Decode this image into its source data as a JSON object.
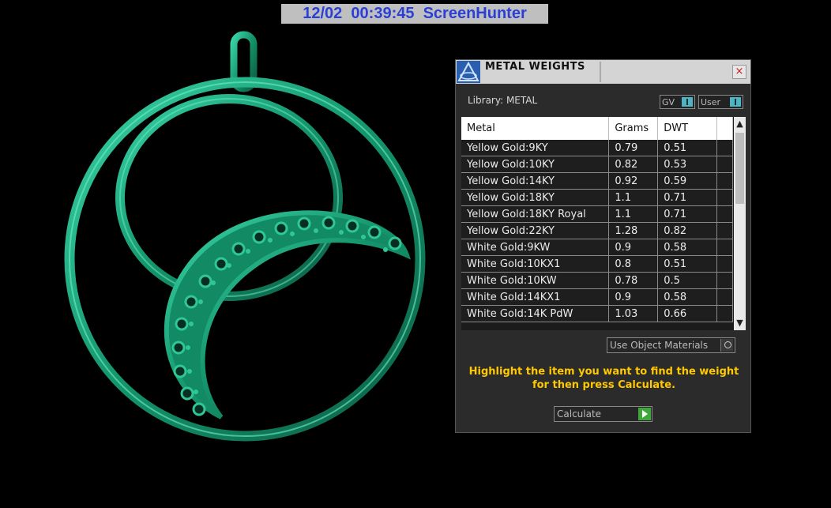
{
  "banner": {
    "text": "12/02  00:39:45  ScreenHunter"
  },
  "panel": {
    "title": "METAL WEIGHTS",
    "close_label": "×",
    "library_label": "Library: METAL",
    "toggle_gv_label": "GV",
    "toggle_user_label": "User",
    "table": {
      "headers": [
        "Metal",
        "Grams",
        "DWT"
      ],
      "rows": [
        [
          "Yellow Gold:9KY",
          "0.79",
          "0.51"
        ],
        [
          "Yellow Gold:10KY",
          "0.82",
          "0.53"
        ],
        [
          "Yellow Gold:14KY",
          "0.92",
          "0.59"
        ],
        [
          "Yellow Gold:18KY",
          "1.1",
          "0.71"
        ],
        [
          "Yellow Gold:18KY Royal",
          "1.1",
          "0.71"
        ],
        [
          "Yellow Gold:22KY",
          "1.28",
          "0.82"
        ],
        [
          "White Gold:9KW",
          "0.9",
          "0.58"
        ],
        [
          "White Gold:10KX1",
          "0.8",
          "0.51"
        ],
        [
          "White Gold:10KW",
          "0.78",
          "0.5"
        ],
        [
          "White Gold:14KX1",
          "0.9",
          "0.58"
        ],
        [
          "White Gold:14K PdW",
          "1.03",
          "0.66"
        ]
      ]
    },
    "scroll_up_icon": "▲",
    "scroll_down_icon": "▼",
    "use_materials_label": "Use Object Materials",
    "instructions": "Highlight the item you want to find the weight for then press Calculate.",
    "calculate_label": "Calculate"
  },
  "colors": {
    "banner_text": "#2b3fd6",
    "instructions": "#ffc800",
    "pendant": "#1aa67c",
    "toggle_accent": "#4fb4c4",
    "calculate_accent": "#3fa63a"
  },
  "icons": {
    "app_icon": "rhino-app-icon",
    "close": "close-icon",
    "play": "play-icon"
  }
}
